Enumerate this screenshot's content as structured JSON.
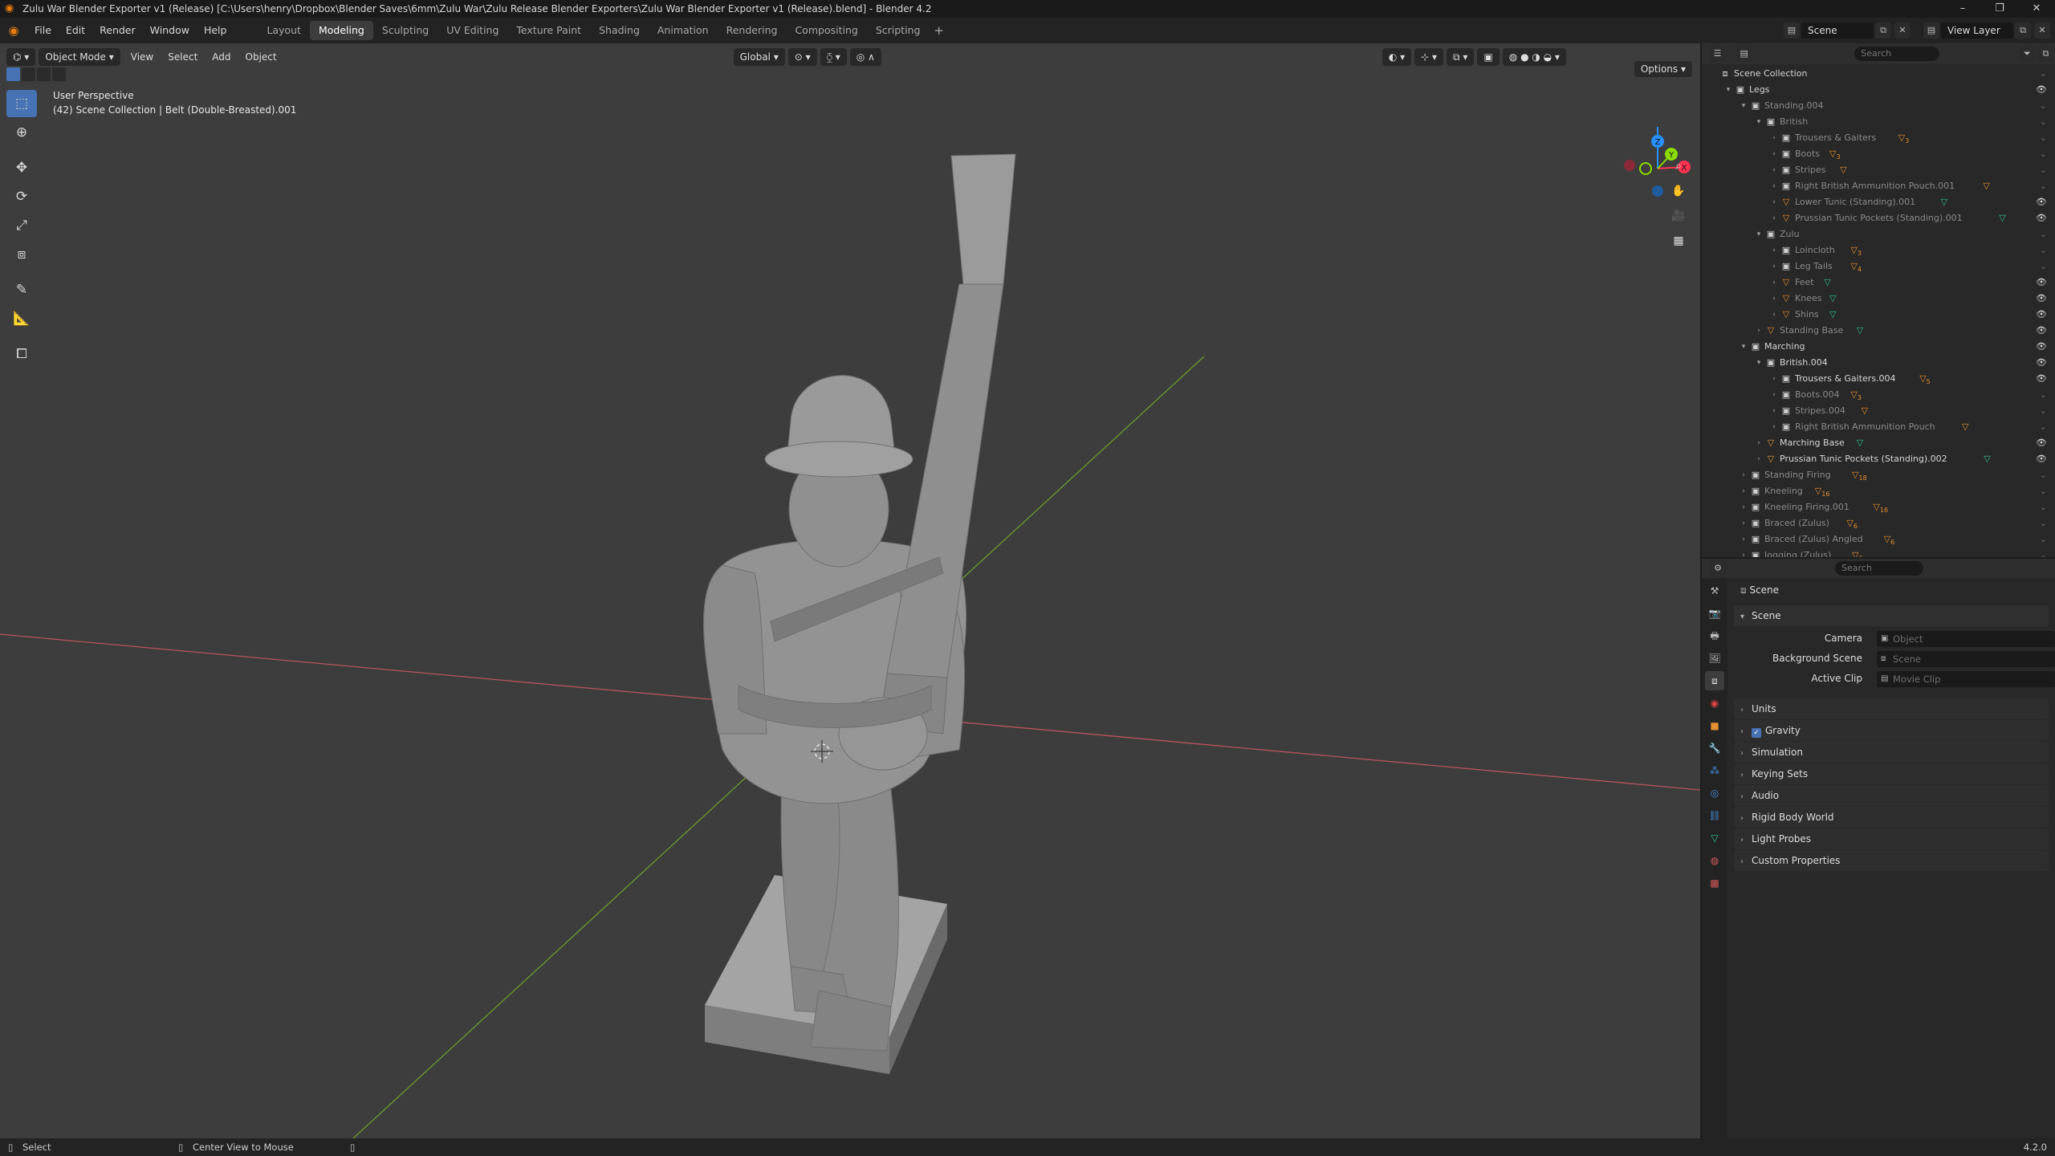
{
  "window": {
    "title": "Zulu War Blender Exporter v1 (Release) [C:\\Users\\henry\\Dropbox\\Blender Saves\\6mm\\Zulu War\\Zulu Release Blender Exporters\\Zulu War Blender Exporter v1 (Release).blend] - Blender 4.2",
    "minimize": "–",
    "maximize": "❐",
    "close": "✕"
  },
  "menu": {
    "items": [
      "File",
      "Edit",
      "Render",
      "Window",
      "Help"
    ],
    "workspaces": [
      "Layout",
      "Modeling",
      "Sculpting",
      "UV Editing",
      "Texture Paint",
      "Shading",
      "Animation",
      "Rendering",
      "Compositing",
      "Scripting"
    ],
    "active_workspace": "Modeling",
    "add": "+",
    "scene": "Scene",
    "view_layer": "View Layer"
  },
  "viewport": {
    "mode": "Object Mode",
    "menus": [
      "View",
      "Select",
      "Add",
      "Object"
    ],
    "orientation": "Global",
    "options": "Options",
    "info_line1": "User Perspective",
    "info_line2": "(42) Scene Collection | Belt (Double-Breasted).001",
    "gizmo": {
      "x": "X",
      "y": "Y",
      "z": "Z"
    }
  },
  "outliner": {
    "search_placeholder": "Search",
    "rows": [
      {
        "label": "Scene Collection",
        "type": "scene"
      },
      {
        "label": "Legs",
        "type": "coll"
      },
      {
        "label": "Standing.004",
        "type": "coll"
      },
      {
        "label": "British",
        "type": "coll"
      },
      {
        "label": "Trousers & Gaiters",
        "type": "coll",
        "badge": "3"
      },
      {
        "label": "Boots",
        "type": "coll",
        "badge": "3"
      },
      {
        "label": "Stripes",
        "type": "coll"
      },
      {
        "label": "Right British Ammunition Pouch.001",
        "type": "coll"
      },
      {
        "label": "Lower Tunic (Standing).001",
        "type": "obj"
      },
      {
        "label": "Prussian Tunic Pockets (Standing).001",
        "type": "obj"
      },
      {
        "label": "Zulu",
        "type": "coll"
      },
      {
        "label": "Loincloth",
        "type": "coll",
        "badge": "3"
      },
      {
        "label": "Leg Tails",
        "type": "coll",
        "badge": "4"
      },
      {
        "label": "Feet",
        "type": "obj"
      },
      {
        "label": "Knees",
        "type": "obj"
      },
      {
        "label": "Shins",
        "type": "obj"
      },
      {
        "label": "Standing Base",
        "type": "obj"
      },
      {
        "label": "Marching",
        "type": "coll"
      },
      {
        "label": "British.004",
        "type": "coll"
      },
      {
        "label": "Trousers & Gaiters.004",
        "type": "coll",
        "badge": "5"
      },
      {
        "label": "Boots.004",
        "type": "coll",
        "badge": "3"
      },
      {
        "label": "Stripes.004",
        "type": "coll"
      },
      {
        "label": "Right British Ammunition Pouch",
        "type": "coll"
      },
      {
        "label": "Marching Base",
        "type": "obj"
      },
      {
        "label": "Prussian Tunic Pockets (Standing).002",
        "type": "obj"
      },
      {
        "label": "Standing Firing",
        "type": "coll",
        "badge": "18"
      },
      {
        "label": "Kneeling",
        "type": "coll",
        "badge": "16"
      },
      {
        "label": "Kneeling Firing.001",
        "type": "coll",
        "badge": "16"
      },
      {
        "label": "Braced (Zulus)",
        "type": "coll",
        "badge": "6"
      },
      {
        "label": "Braced (Zulus) Angled",
        "type": "coll",
        "badge": "6"
      },
      {
        "label": "Jogging (Zulus)",
        "type": "coll",
        "badge": "6"
      }
    ]
  },
  "properties": {
    "search_placeholder": "Search",
    "breadcrumb": "Scene",
    "panel": "Scene",
    "camera_label": "Camera",
    "camera_placeholder": "Object",
    "background_label": "Background Scene",
    "background_placeholder": "Scene",
    "clip_label": "Active Clip",
    "clip_placeholder": "Movie Clip",
    "subpanels": [
      "Units",
      "Gravity",
      "Simulation",
      "Keying Sets",
      "Audio",
      "Rigid Body World",
      "Light Probes",
      "Custom Properties"
    ]
  },
  "status": {
    "select": "Select",
    "center": "Center View to Mouse",
    "version": "4.2.0"
  },
  "colors": {
    "accent": "#4772b3",
    "x_axis": "#ff3352",
    "y_axis": "#8bdc00",
    "z_axis": "#2890ff",
    "mesh": "#8a8a8a"
  }
}
